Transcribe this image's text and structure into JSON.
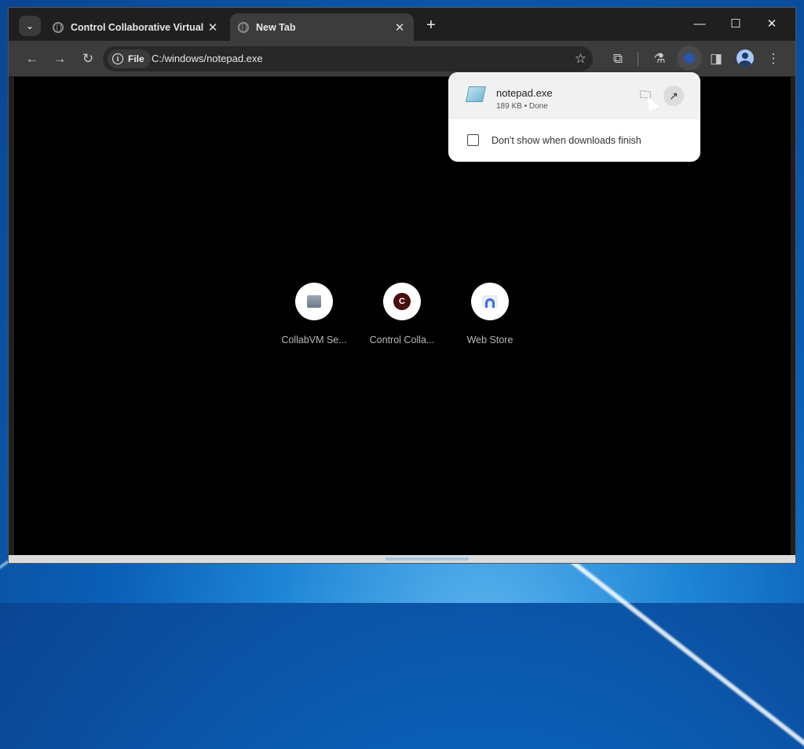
{
  "tabs": [
    {
      "title": "Control Collaborative Virtual M",
      "close": "✕",
      "active": false
    },
    {
      "title": "New Tab",
      "close": "✕",
      "active": true
    }
  ],
  "tabstrip": {
    "search_icon": "⌄",
    "new_tab": "+"
  },
  "window_controls": {
    "minimize": "—",
    "maximize": "☐",
    "close": "✕"
  },
  "toolbar": {
    "back": "←",
    "forward": "→",
    "reload": "↻",
    "site_chip_label": "File",
    "url": "C:/windows/notepad.exe",
    "star": "☆",
    "extensions": "⧉",
    "labs": "⚗",
    "side_panel": "◨",
    "menu": "⋮"
  },
  "shortcuts": [
    {
      "label": "CollabVM Se...",
      "icon": "collabvm-icon"
    },
    {
      "label": "Control Colla...",
      "icon": "c-letter-icon",
      "letter": "C"
    },
    {
      "label": "Web Store",
      "icon": "web-store-icon"
    }
  ],
  "download_bubble": {
    "file_name": "notepad.exe",
    "meta": "189 KB • Done",
    "show_in_folder": "🗀",
    "open_file": "↗",
    "checkbox_label": "Don't show when downloads finish",
    "checkbox_checked": false
  }
}
